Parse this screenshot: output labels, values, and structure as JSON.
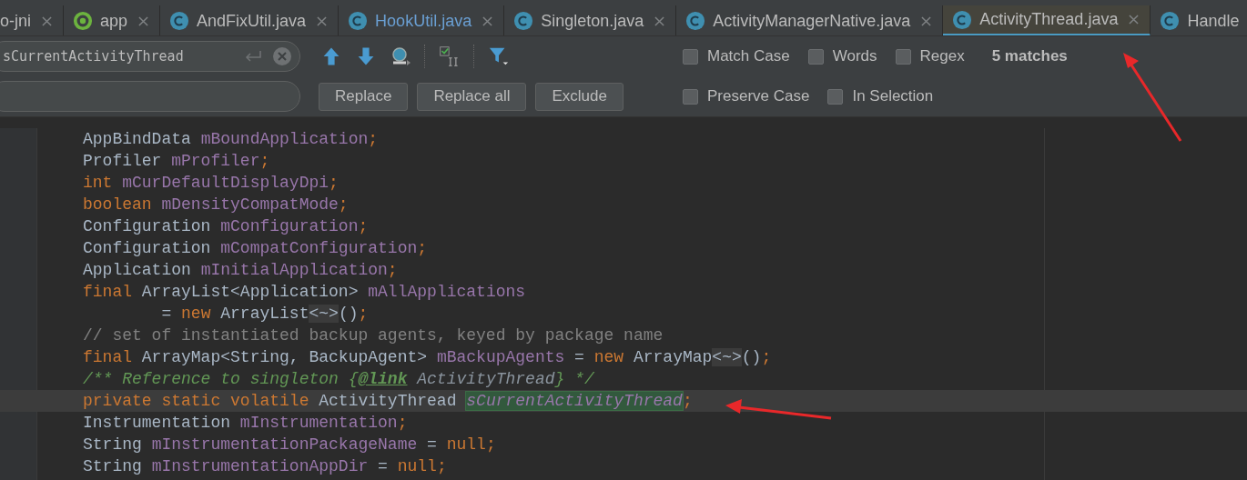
{
  "tabs": [
    {
      "label": "o-jni",
      "kind": "plain",
      "selected": false,
      "modified": false,
      "closable": true
    },
    {
      "label": "app",
      "kind": "module",
      "selected": false,
      "modified": false,
      "closable": true
    },
    {
      "label": "AndFixUtil.java",
      "kind": "class",
      "selected": false,
      "modified": false,
      "closable": true
    },
    {
      "label": "HookUtil.java",
      "kind": "class",
      "selected": false,
      "modified": true,
      "closable": true
    },
    {
      "label": "Singleton.java",
      "kind": "class",
      "selected": false,
      "modified": false,
      "closable": true
    },
    {
      "label": "ActivityManagerNative.java",
      "kind": "class",
      "selected": false,
      "modified": false,
      "closable": true
    },
    {
      "label": "ActivityThread.java",
      "kind": "class",
      "selected": true,
      "modified": false,
      "closable": true
    },
    {
      "label": "Handle",
      "kind": "class",
      "selected": false,
      "modified": false,
      "closable": false
    }
  ],
  "find": {
    "search_value": "sCurrentActivityThread",
    "buttons": [
      "Replace",
      "Replace all",
      "Exclude"
    ],
    "options": [
      [
        {
          "label": "Match Case",
          "checked": false
        },
        {
          "label": "Words",
          "checked": false
        },
        {
          "label": "Regex",
          "checked": false
        }
      ],
      [
        {
          "label": "Preserve Case",
          "checked": false
        },
        {
          "label": "In Selection",
          "checked": false
        }
      ]
    ],
    "match_count": "5 matches"
  },
  "code": [
    {
      "current": false,
      "tokens": [
        {
          "t": "AppBindData ",
          "kind": "plain"
        },
        {
          "t": "mBoundApplication",
          "kind": "field"
        },
        {
          "t": ";",
          "kind": "kw"
        }
      ]
    },
    {
      "current": false,
      "tokens": [
        {
          "t": "Profiler ",
          "kind": "plain"
        },
        {
          "t": "mProfiler",
          "kind": "field"
        },
        {
          "t": ";",
          "kind": "kw"
        }
      ]
    },
    {
      "current": false,
      "tokens": [
        {
          "t": "int ",
          "kind": "kw"
        },
        {
          "t": "mCurDefaultDisplayDpi",
          "kind": "field"
        },
        {
          "t": ";",
          "kind": "kw"
        }
      ]
    },
    {
      "current": false,
      "tokens": [
        {
          "t": "boolean ",
          "kind": "kw"
        },
        {
          "t": "mDensityCompatMode",
          "kind": "field"
        },
        {
          "t": ";",
          "kind": "kw"
        }
      ]
    },
    {
      "current": false,
      "tokens": [
        {
          "t": "Configuration ",
          "kind": "plain"
        },
        {
          "t": "mConfiguration",
          "kind": "field"
        },
        {
          "t": ";",
          "kind": "kw"
        }
      ]
    },
    {
      "current": false,
      "tokens": [
        {
          "t": "Configuration ",
          "kind": "plain"
        },
        {
          "t": "mCompatConfiguration",
          "kind": "field"
        },
        {
          "t": ";",
          "kind": "kw"
        }
      ]
    },
    {
      "current": false,
      "tokens": [
        {
          "t": "Application ",
          "kind": "plain"
        },
        {
          "t": "mInitialApplication",
          "kind": "field"
        },
        {
          "t": ";",
          "kind": "kw"
        }
      ]
    },
    {
      "current": false,
      "tokens": [
        {
          "t": "final ",
          "kind": "kw"
        },
        {
          "t": "ArrayList<Application> ",
          "kind": "plain"
        },
        {
          "t": "mAllApplications",
          "kind": "field"
        }
      ]
    },
    {
      "current": false,
      "tokens": [
        {
          "t": "        = ",
          "kind": "plain"
        },
        {
          "t": "new ",
          "kind": "kw"
        },
        {
          "t": "ArrayList",
          "kind": "plain"
        },
        {
          "t": "<~>",
          "kind": "fold"
        },
        {
          "t": "()",
          "kind": "plain"
        },
        {
          "t": ";",
          "kind": "kw"
        }
      ]
    },
    {
      "current": false,
      "tokens": [
        {
          "t": "// set of instantiated backup agents, keyed by package name",
          "kind": "comment"
        }
      ]
    },
    {
      "current": false,
      "tokens": [
        {
          "t": "final ",
          "kind": "kw"
        },
        {
          "t": "ArrayMap<String, BackupAgent> ",
          "kind": "plain"
        },
        {
          "t": "mBackupAgents",
          "kind": "field"
        },
        {
          "t": " = ",
          "kind": "plain"
        },
        {
          "t": "new ",
          "kind": "kw"
        },
        {
          "t": "ArrayMap",
          "kind": "plain"
        },
        {
          "t": "<~>",
          "kind": "fold"
        },
        {
          "t": "()",
          "kind": "plain"
        },
        {
          "t": ";",
          "kind": "kw"
        }
      ]
    },
    {
      "current": false,
      "tokens": [
        {
          "t": "/** Reference to singleton {",
          "kind": "doc"
        },
        {
          "t": "@link",
          "kind": "doctag"
        },
        {
          "t": " ActivityThread",
          "kind": "docref"
        },
        {
          "t": "} */",
          "kind": "doc"
        }
      ]
    },
    {
      "current": true,
      "tokens": [
        {
          "t": "private static volatile ",
          "kind": "kw"
        },
        {
          "t": "ActivityThread ",
          "kind": "plain"
        },
        {
          "t": "sCurrentActivityThread",
          "kind": "match"
        },
        {
          "t": ";",
          "kind": "kw"
        }
      ]
    },
    {
      "current": false,
      "tokens": [
        {
          "t": "Instrumentation ",
          "kind": "plain"
        },
        {
          "t": "mInstrumentation",
          "kind": "field"
        },
        {
          "t": ";",
          "kind": "kw"
        }
      ]
    },
    {
      "current": false,
      "tokens": [
        {
          "t": "String ",
          "kind": "plain"
        },
        {
          "t": "mInstrumentationPackageName",
          "kind": "field"
        },
        {
          "t": " = ",
          "kind": "plain"
        },
        {
          "t": "null",
          "kind": "kw"
        },
        {
          "t": ";",
          "kind": "kw"
        }
      ]
    },
    {
      "current": false,
      "tokens": [
        {
          "t": "String ",
          "kind": "plain"
        },
        {
          "t": "mInstrumentationAppDir",
          "kind": "field"
        },
        {
          "t": " = ",
          "kind": "plain"
        },
        {
          "t": "null",
          "kind": "kw"
        },
        {
          "t": ";",
          "kind": "kw"
        }
      ]
    }
  ]
}
